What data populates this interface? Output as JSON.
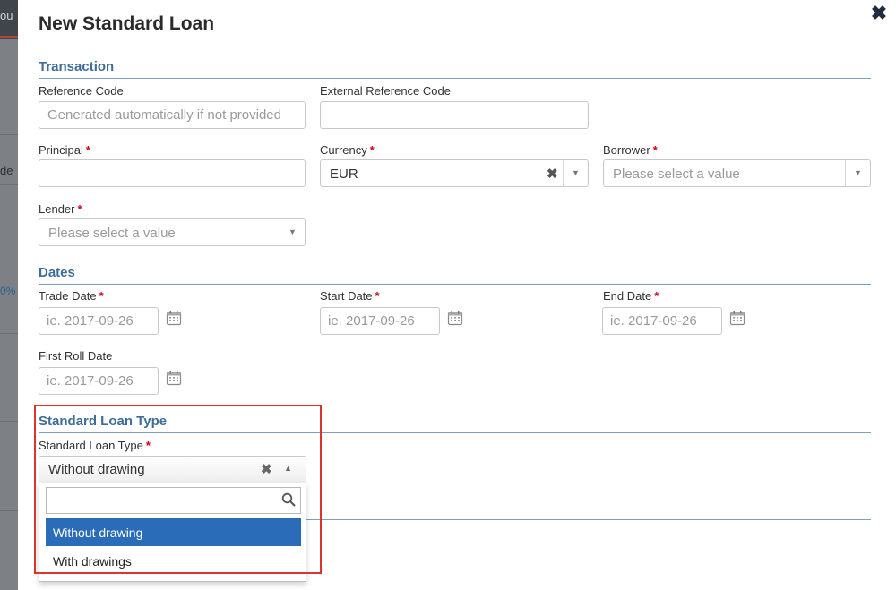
{
  "backdrop": {
    "text_1": "ou",
    "text_2": "de",
    "text_3": "0%"
  },
  "modal": {
    "title": "New Standard Loan",
    "close_icon": "close-icon"
  },
  "required_mark": "*",
  "transaction": {
    "section_title": "Transaction",
    "reference_code": {
      "label": "Reference Code",
      "placeholder": "Generated automatically if not provided",
      "value": ""
    },
    "external_reference_code": {
      "label": "External Reference Code",
      "value": ""
    },
    "principal": {
      "label": "Principal",
      "value": ""
    },
    "currency": {
      "label": "Currency",
      "value": "EUR"
    },
    "borrower": {
      "label": "Borrower",
      "placeholder": "Please select a value"
    },
    "lender": {
      "label": "Lender",
      "placeholder": "Please select a value"
    }
  },
  "dates": {
    "section_title": "Dates",
    "trade_date": {
      "label": "Trade Date",
      "placeholder": "ie. 2017-09-26"
    },
    "start_date": {
      "label": "Start Date",
      "placeholder": "ie. 2017-09-26"
    },
    "end_date": {
      "label": "End Date",
      "placeholder": "ie. 2017-09-26"
    },
    "first_roll_date": {
      "label": "First Roll Date",
      "placeholder": "ie. 2017-09-26"
    }
  },
  "standard_loan_type": {
    "section_title": "Standard Loan Type",
    "label": "Standard Loan Type",
    "value": "Without drawing",
    "search_value": "",
    "options": [
      "Without drawing",
      "With drawings"
    ],
    "selected_index": 0
  },
  "colors": {
    "accent": "#3f6d99",
    "required": "#d0021b",
    "highlight_box": "#e0332a",
    "option_active": "#2b6cb8"
  }
}
